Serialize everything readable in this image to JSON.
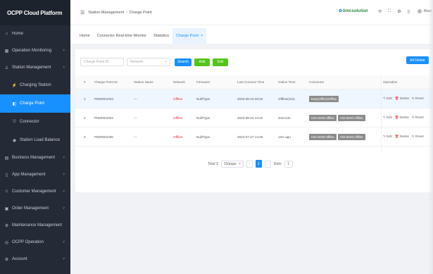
{
  "app_title": "OCPP Cloud Platform",
  "sidebar": {
    "items": [
      {
        "label": "Home",
        "icon": "home-icon",
        "glyph": "⌂"
      },
      {
        "label": "Operation Monitoring",
        "icon": "monitor-icon",
        "glyph": "▦",
        "arrow": "˅"
      },
      {
        "label": "Station Management",
        "icon": "station-icon",
        "glyph": "♙",
        "arrow": "˄"
      },
      {
        "label": "Charging Station",
        "icon": "charging-station-icon",
        "glyph": "⚡",
        "sub": true
      },
      {
        "label": "Charge Point",
        "icon": "charge-point-icon",
        "glyph": "◧",
        "sub": true,
        "active": true
      },
      {
        "label": "Connector",
        "icon": "connector-icon",
        "glyph": "⎋",
        "sub": true
      },
      {
        "label": "Station Load Balance",
        "icon": "load-balance-icon",
        "glyph": "◉",
        "sub": true
      },
      {
        "label": "Business Management",
        "icon": "business-icon",
        "glyph": "▤",
        "arrow": "˅"
      },
      {
        "label": "App Management",
        "icon": "app-icon",
        "glyph": "▯",
        "arrow": "˅"
      },
      {
        "label": "Customer Management",
        "icon": "customer-icon",
        "glyph": "☺",
        "arrow": "˅"
      },
      {
        "label": "Order Management",
        "icon": "order-icon",
        "glyph": "▣",
        "arrow": "˅"
      },
      {
        "label": "Maintenance Management",
        "icon": "maintenance-icon",
        "glyph": "⚙"
      },
      {
        "label": "OCPP Operation",
        "icon": "ocpp-icon",
        "glyph": "◎",
        "arrow": "˅"
      },
      {
        "label": "Account",
        "icon": "account-icon",
        "glyph": "⚙",
        "arrow": "˅"
      }
    ]
  },
  "header": {
    "menu_icon": "☰",
    "breadcrumb": [
      "Station Management",
      "Charge Point"
    ],
    "breadcrumb_sep": "/",
    "logo_text": "bmcsolution",
    "icons": [
      "⟲",
      "⛶",
      "⚙",
      "▯"
    ],
    "user": "Root"
  },
  "tabs": [
    {
      "label": "Home"
    },
    {
      "label": "Connector Real-time Monitor"
    },
    {
      "label": "Statistics"
    },
    {
      "label": "Charge Point",
      "active": true,
      "close": "×"
    }
  ],
  "filters": {
    "charge_point_placeholder": "Charge Point ID",
    "status_placeholder": "Network",
    "search_label": "Search",
    "add_label": "Add",
    "edit_label": "Edit",
    "right_button_label": "All Delete"
  },
  "table": {
    "headers": [
      "#",
      "Charge Point ID",
      "Station Name",
      "Network",
      "Firmware",
      "Last Connect Time",
      "Online Time",
      "Connector",
      "Operation"
    ],
    "rows": [
      {
        "index": "1",
        "id": "PN00001003",
        "station": "---",
        "network": "Offline",
        "firmware": "Null/Type",
        "last_connect": "2023-08-15 08:32",
        "online": "Offline(min)",
        "connectors": [
          "Busy(Offline)Offline"
        ],
        "highlight": true
      },
      {
        "index": "2",
        "id": "PN00001004",
        "station": "---",
        "network": "Offline",
        "firmware": "Null/Type",
        "last_connect": "2023-08-15 14:42",
        "online": "4min13s",
        "connectors": [
          "C01-MAIN Offline",
          "C02-MAIN Offline"
        ],
        "highlight": false
      },
      {
        "index": "3",
        "id": "PN00001005",
        "station": "---",
        "network": "Offline",
        "firmware": "Null/Type",
        "last_connect": "2023-07-27 14:25",
        "online": "13m ago",
        "connectors": [
          "C01-MAIN Offline",
          "C02-MAIN Offline"
        ],
        "highlight": false
      }
    ],
    "ops": {
      "edit": "Edit",
      "delete": "Delete",
      "reset": "Reset"
    }
  },
  "pagination": {
    "total": "Total 3",
    "page_size": "10/page",
    "prev": "‹",
    "current": "1",
    "next": "›",
    "goto": "Goto",
    "goto_value": "1"
  },
  "colors": {
    "accent": "#1890ff",
    "success": "#52c41a",
    "danger": "#f5222d",
    "sidebar_bg": "#242b36"
  }
}
